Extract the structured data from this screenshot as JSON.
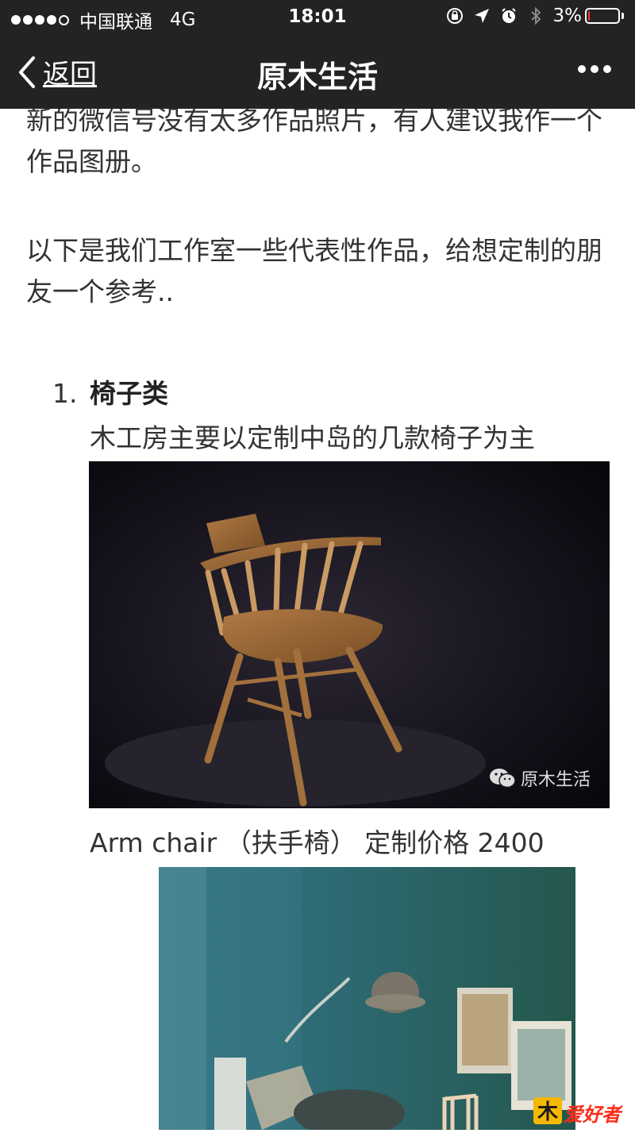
{
  "status_bar": {
    "carrier": "中国联通",
    "network": "4G",
    "time": "18:01",
    "battery": "3%"
  },
  "nav": {
    "back_label": "返回",
    "title": "原木生活"
  },
  "article": {
    "paragraph1": "新的微信号没有太多作品照片，有人建议我作一个作品图册。",
    "paragraph2": "以下是我们工作室一些代表性作品，给想定制的朋友一个参考..",
    "list": {
      "number": "1.",
      "heading": "椅子类",
      "subtext": "木工房主要以定制中岛的几款椅子为主"
    },
    "photo1_watermark": "原木生活",
    "photo1_caption": "Arm chair （扶手椅） 定制价格 2400"
  },
  "corner_logo": {
    "mark": "木",
    "text": "爱好者"
  },
  "colors": {
    "topbar": "#232323",
    "body_text": "#333333",
    "battery_low": "#ff3b30"
  }
}
